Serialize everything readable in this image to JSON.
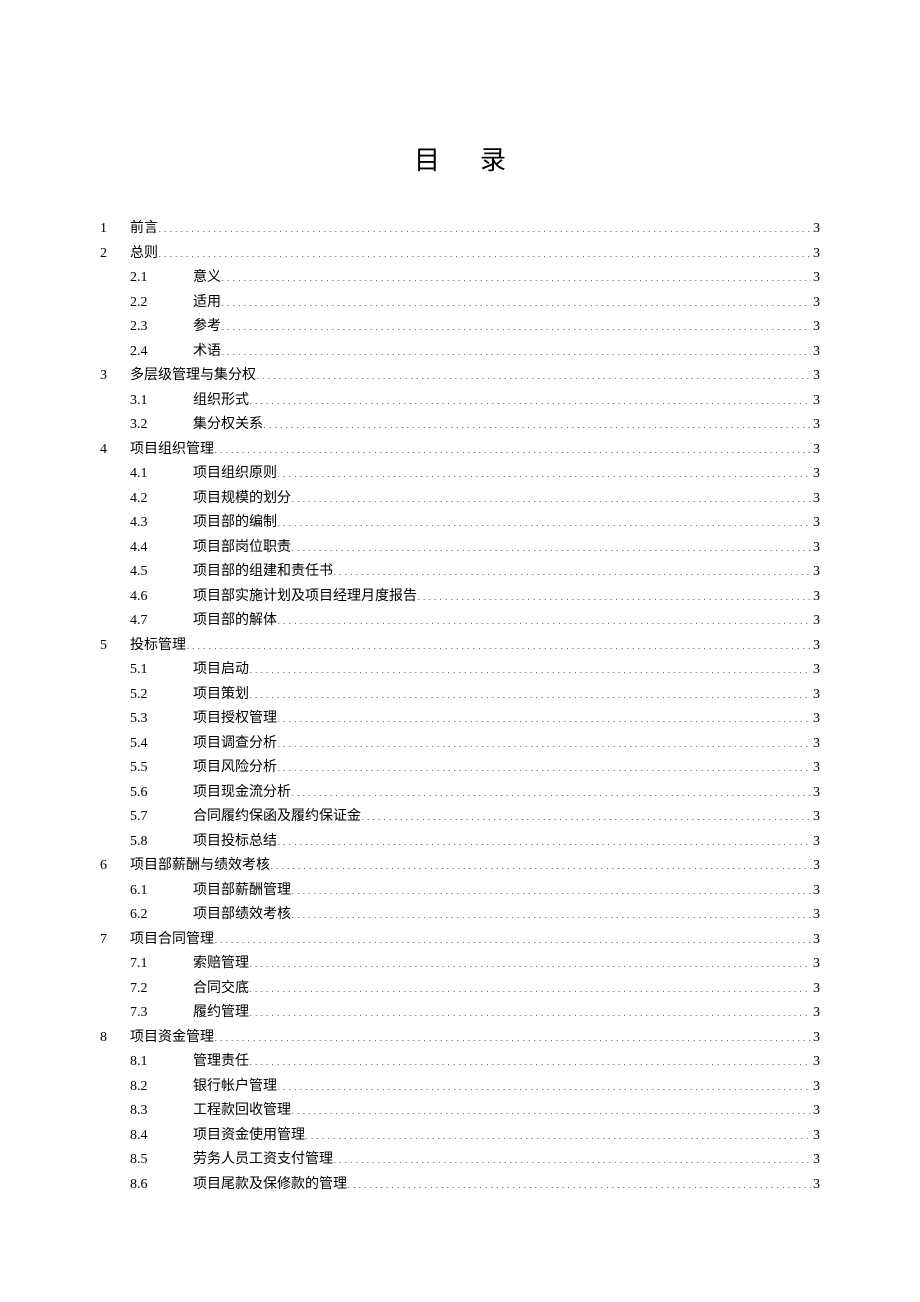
{
  "title": "目录",
  "toc": [
    {
      "level": 1,
      "num": "1",
      "sub": "",
      "text": "前言",
      "page": "3"
    },
    {
      "level": 1,
      "num": "2",
      "sub": "",
      "text": "总则",
      "page": "3"
    },
    {
      "level": 2,
      "num": "",
      "sub": "2.1",
      "text": "意义",
      "page": "3"
    },
    {
      "level": 2,
      "num": "",
      "sub": "2.2",
      "text": "适用",
      "page": "3"
    },
    {
      "level": 2,
      "num": "",
      "sub": "2.3",
      "text": "参考",
      "page": "3"
    },
    {
      "level": 2,
      "num": "",
      "sub": "2.4",
      "text": "术语",
      "page": "3"
    },
    {
      "level": 1,
      "num": "3",
      "sub": "",
      "text": "多层级管理与集分权",
      "page": "3"
    },
    {
      "level": 2,
      "num": "",
      "sub": "3.1",
      "text": "组织形式",
      "page": "3"
    },
    {
      "level": 2,
      "num": "",
      "sub": "3.2",
      "text": "集分权关系",
      "page": "3"
    },
    {
      "level": 1,
      "num": "4",
      "sub": "",
      "text": "项目组织管理",
      "page": "3"
    },
    {
      "level": 2,
      "num": "",
      "sub": "4.1",
      "text": "项目组织原则",
      "page": "3"
    },
    {
      "level": 2,
      "num": "",
      "sub": "4.2",
      "text": "项目规模的划分",
      "page": "3"
    },
    {
      "level": 2,
      "num": "",
      "sub": "4.3",
      "text": "项目部的编制",
      "page": "3"
    },
    {
      "level": 2,
      "num": "",
      "sub": "4.4",
      "text": "项目部岗位职责",
      "page": "3"
    },
    {
      "level": 2,
      "num": "",
      "sub": "4.5",
      "text": "项目部的组建和责任书",
      "page": "3"
    },
    {
      "level": 2,
      "num": "",
      "sub": "4.6",
      "text": "项目部实施计划及项目经理月度报告",
      "page": "3"
    },
    {
      "level": 2,
      "num": "",
      "sub": "4.7",
      "text": "项目部的解体",
      "page": "3"
    },
    {
      "level": 1,
      "num": "5",
      "sub": "",
      "text": "投标管理",
      "page": "3"
    },
    {
      "level": 2,
      "num": "",
      "sub": "5.1",
      "text": "项目启动",
      "page": "3"
    },
    {
      "level": 2,
      "num": "",
      "sub": "5.2",
      "text": "项目策划",
      "page": "3"
    },
    {
      "level": 2,
      "num": "",
      "sub": "5.3",
      "text": "项目授权管理",
      "page": "3"
    },
    {
      "level": 2,
      "num": "",
      "sub": "5.4",
      "text": "项目调查分析",
      "page": "3"
    },
    {
      "level": 2,
      "num": "",
      "sub": "5.5",
      "text": "项目风险分析",
      "page": "3"
    },
    {
      "level": 2,
      "num": "",
      "sub": "5.6",
      "text": "项目现金流分析",
      "page": "3"
    },
    {
      "level": 2,
      "num": "",
      "sub": "5.7",
      "text": "合同履约保函及履约保证金",
      "page": "3"
    },
    {
      "level": 2,
      "num": "",
      "sub": "5.8",
      "text": "项目投标总结",
      "page": "3"
    },
    {
      "level": 1,
      "num": "6",
      "sub": "",
      "text": "项目部薪酬与绩效考核",
      "page": "3"
    },
    {
      "level": 2,
      "num": "",
      "sub": "6.1",
      "text": "项目部薪酬管理",
      "page": "3"
    },
    {
      "level": 2,
      "num": "",
      "sub": "6.2",
      "text": "项目部绩效考核",
      "page": "3"
    },
    {
      "level": 1,
      "num": "7",
      "sub": "",
      "text": "项目合同管理",
      "page": "3"
    },
    {
      "level": 2,
      "num": "",
      "sub": "7.1",
      "text": "索赔管理",
      "page": "3"
    },
    {
      "level": 2,
      "num": "",
      "sub": "7.2",
      "text": "合同交底",
      "page": "3"
    },
    {
      "level": 2,
      "num": "",
      "sub": "7.3",
      "text": "履约管理",
      "page": "3"
    },
    {
      "level": 1,
      "num": "8",
      "sub": "",
      "text": "项目资金管理",
      "page": "3"
    },
    {
      "level": 2,
      "num": "",
      "sub": "8.1",
      "text": "管理责任",
      "page": "3"
    },
    {
      "level": 2,
      "num": "",
      "sub": "8.2",
      "text": "银行帐户管理",
      "page": "3"
    },
    {
      "level": 2,
      "num": "",
      "sub": "8.3",
      "text": "工程款回收管理",
      "page": "3"
    },
    {
      "level": 2,
      "num": "",
      "sub": "8.4",
      "text": "项目资金使用管理",
      "page": "3"
    },
    {
      "level": 2,
      "num": "",
      "sub": "8.5",
      "text": "劳务人员工资支付管理",
      "page": "3"
    },
    {
      "level": 2,
      "num": "",
      "sub": "8.6",
      "text": "项目尾款及保修款的管理",
      "page": "3"
    }
  ]
}
